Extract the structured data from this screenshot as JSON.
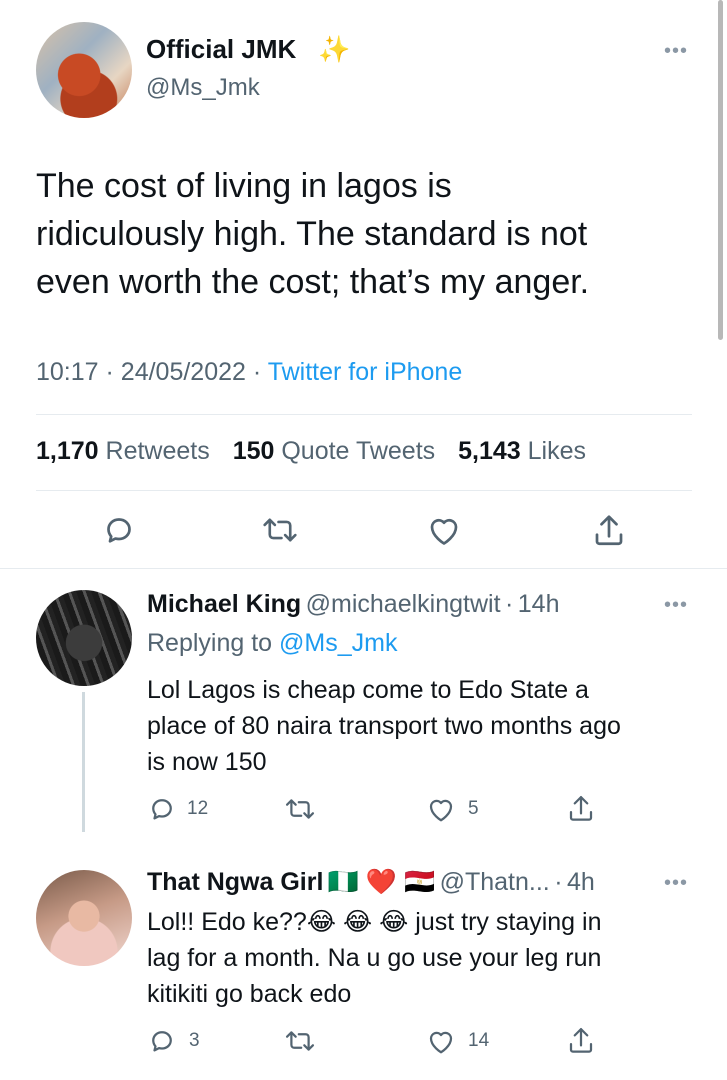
{
  "tweet": {
    "author_name": "Official JMK",
    "author_badge": "✨",
    "handle": "@Ms_Jmk",
    "text_lines": [
      "The cost of living in lagos is",
      "ridiculously high. The standard is not",
      "even worth the cost; that’s my anger."
    ],
    "time": "10:17",
    "date": "24/05/2022",
    "client": "Twitter for iPhone",
    "retweets_count": "1,170",
    "retweets_label": "Retweets",
    "quotes_count": "150",
    "quotes_label": "Quote Tweets",
    "likes_count": "5,143",
    "likes_label": "Likes",
    "more_icon": "more-horizontal-icon"
  },
  "replies": [
    {
      "name": "Michael King",
      "handle": "@michaelkingtwit",
      "time": "14h",
      "replying_prefix": "Replying to",
      "replying_handle": "@Ms_Jmk",
      "text_lines": [
        "Lol Lagos is cheap come to Edo State a",
        "place of 80 naira transport two months ago",
        "is now 150"
      ],
      "replies_count": "12",
      "likes_count": "5"
    },
    {
      "name": "That Ngwa Girl",
      "name_emojis": "🇳🇬 ❤️ 🇪🇬",
      "handle": "@Thatn...",
      "time": "4h",
      "text_lines": [
        "Lol!! Edo ke??😂 😂 😂 just try staying in",
        "lag for a month. Na u go use your leg run",
        "kitikiti go back edo"
      ],
      "replies_count": "3",
      "likes_count": "14"
    }
  ],
  "colors": {
    "accent": "#1d9bf0",
    "muted": "#536471",
    "divider": "#e6ebef"
  }
}
